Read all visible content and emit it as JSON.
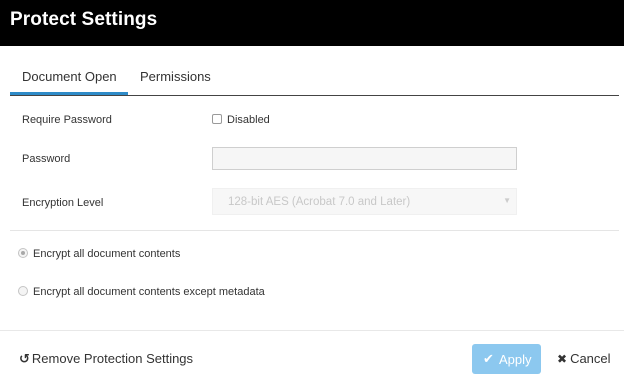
{
  "dialog": {
    "title": "Protect Settings"
  },
  "tabs": [
    {
      "label": "Document Open",
      "active": true
    },
    {
      "label": "Permissions",
      "active": false
    }
  ],
  "form": {
    "require_password": {
      "label": "Require Password",
      "checkbox_label": "Disabled",
      "checked": false
    },
    "password": {
      "label": "Password",
      "value": ""
    },
    "encryption_level": {
      "label": "Encryption Level",
      "selected": "128-bit AES (Acrobat 7.0 and Later)"
    }
  },
  "encrypt_options": [
    {
      "label": "Encrypt all document contents",
      "selected": true
    },
    {
      "label": "Encrypt all document contents except metadata",
      "selected": false
    }
  ],
  "footer": {
    "remove_label": "Remove Protection Settings",
    "remove_icon": "undo-icon",
    "apply_label": "Apply",
    "apply_icon": "check-icon",
    "cancel_label": "Cancel",
    "cancel_icon": "close-icon"
  },
  "colors": {
    "title_bar": "#000000",
    "tab_accent": "#2e8bc8",
    "apply_button": "#8cc8ef"
  }
}
